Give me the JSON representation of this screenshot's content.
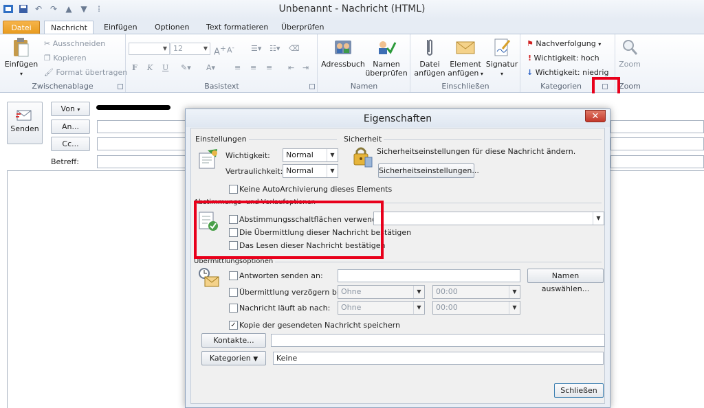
{
  "window": {
    "title": "Unbenannt - Nachricht (HTML)"
  },
  "tabs": [
    {
      "label": "Datei"
    },
    {
      "label": "Nachricht"
    },
    {
      "label": "Einfügen"
    },
    {
      "label": "Optionen"
    },
    {
      "label": "Text formatieren"
    },
    {
      "label": "Überprüfen"
    }
  ],
  "ribbon": {
    "clipboard": {
      "paste": "Einfügen",
      "cut": "Ausschneiden",
      "copy": "Kopieren",
      "format_painter": "Format übertragen",
      "group": "Zwischenablage"
    },
    "basictext": {
      "font_size": "12",
      "group": "Basistext"
    },
    "names": {
      "addressbook": "Adressbuch",
      "check_names_1": "Namen",
      "check_names_2": "überprüfen",
      "group": "Namen"
    },
    "include": {
      "attach_file_1": "Datei",
      "attach_file_2": "anfügen",
      "attach_item_1": "Element",
      "attach_item_2": "anfügen",
      "signature": "Signatur",
      "group": "Einschließen"
    },
    "tags": {
      "followup": "Nachverfolgung",
      "high": "Wichtigkeit: hoch",
      "low": "Wichtigkeit: niedrig",
      "group": "Kategorien"
    },
    "zoom": {
      "label": "Zoom",
      "group": "Zoom"
    }
  },
  "compose": {
    "send": "Senden",
    "from": "Von",
    "to": "An...",
    "cc": "Cc...",
    "subject": "Betreff:"
  },
  "dialog": {
    "title": "Eigenschaften",
    "settings": {
      "heading": "Einstellungen",
      "importance_label": "Wichtigkeit:",
      "importance_value": "Normal",
      "sensitivity_label": "Vertraulichkeit:",
      "sensitivity_value": "Normal",
      "no_autoarchive": "Keine AutoArchivierung dieses Elements"
    },
    "security": {
      "heading": "Sicherheit",
      "text": "Sicherheitseinstellungen für diese Nachricht ändern.",
      "button": "Sicherheitseinstellungen..."
    },
    "voting": {
      "heading": "Abstimmungs- und Verlaufoptionen",
      "use_voting": "Abstimmungsschaltflächen verwenden:",
      "delivery_receipt": "Die Übermittlung dieser Nachricht bestätigen",
      "read_receipt": "Das Lesen dieser Nachricht bestätigen"
    },
    "delivery": {
      "heading": "Übermittlungsoptionen",
      "replies_to": "Antworten senden an:",
      "select_names": "Namen auswählen...",
      "delay": "Übermittlung verzögern bis:",
      "expires": "Nachricht läuft ab nach:",
      "date_none": "Ohne",
      "time_zero": "00:00",
      "save_copy": "Kopie der gesendeten Nachricht speichern"
    },
    "contacts_button": "Kontakte...",
    "categories_button": "Kategorien",
    "categories_value": "Keine",
    "close_button": "Schließen"
  }
}
